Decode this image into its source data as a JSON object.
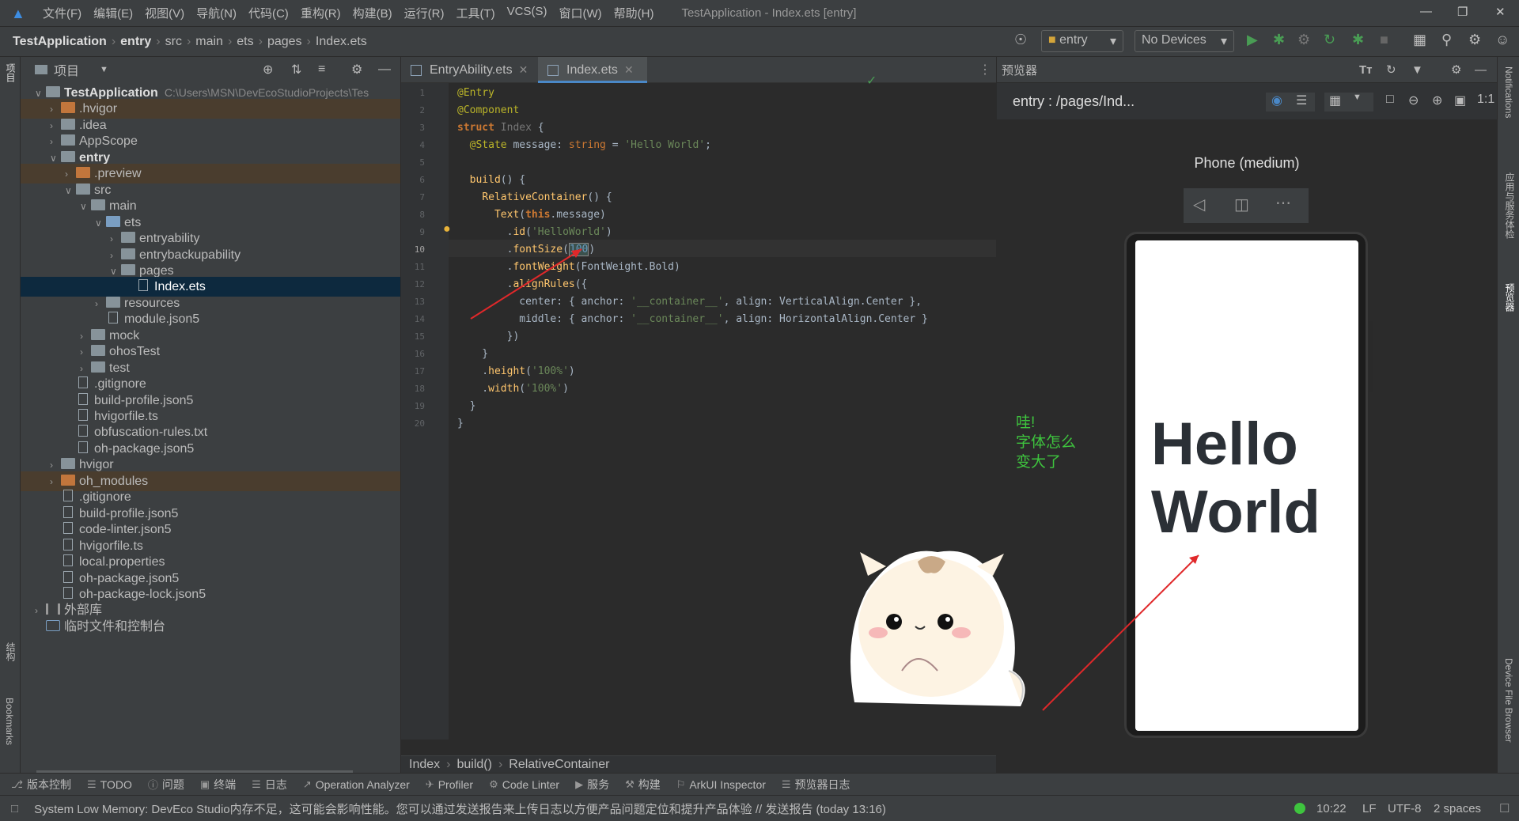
{
  "menu": {
    "items": [
      "文件(F)",
      "编辑(E)",
      "视图(V)",
      "导航(N)",
      "代码(C)",
      "重构(R)",
      "构建(B)",
      "运行(R)",
      "工具(T)",
      "VCS(S)",
      "窗口(W)",
      "帮助(H)"
    ],
    "window_title": "TestApplication - Index.ets [entry]"
  },
  "breadcrumb": [
    "TestApplication",
    "entry",
    "src",
    "main",
    "ets",
    "pages",
    "Index.ets"
  ],
  "toolbar": {
    "module_select": "entry",
    "device_select": "No Devices"
  },
  "project": {
    "header_label": "项目",
    "tree": [
      {
        "depth": 0,
        "arrow": "v",
        "icon": "folder",
        "label": "TestApplication",
        "suffix": "C:\\Users\\MSN\\DevEcoStudioProjects\\Tes",
        "bold": true
      },
      {
        "depth": 1,
        "arrow": ">",
        "icon": "folder-orange",
        "label": ".hvigor",
        "hl": true
      },
      {
        "depth": 1,
        "arrow": ">",
        "icon": "folder",
        "label": ".idea"
      },
      {
        "depth": 1,
        "arrow": ">",
        "icon": "folder",
        "label": "AppScope"
      },
      {
        "depth": 1,
        "arrow": "v",
        "icon": "folder",
        "label": "entry",
        "bold": true
      },
      {
        "depth": 2,
        "arrow": ">",
        "icon": "folder-orange",
        "label": ".preview",
        "hl": true
      },
      {
        "depth": 2,
        "arrow": "v",
        "icon": "folder",
        "label": "src"
      },
      {
        "depth": 3,
        "arrow": "v",
        "icon": "folder",
        "label": "main"
      },
      {
        "depth": 4,
        "arrow": "v",
        "icon": "folder-blue",
        "label": "ets"
      },
      {
        "depth": 5,
        "arrow": ">",
        "icon": "folder",
        "label": "entryability"
      },
      {
        "depth": 5,
        "arrow": ">",
        "icon": "folder",
        "label": "entrybackupability"
      },
      {
        "depth": 5,
        "arrow": "v",
        "icon": "folder",
        "label": "pages"
      },
      {
        "depth": 6,
        "arrow": "",
        "icon": "file",
        "label": "Index.ets",
        "sel": true
      },
      {
        "depth": 4,
        "arrow": ">",
        "icon": "folder",
        "label": "resources"
      },
      {
        "depth": 4,
        "arrow": "",
        "icon": "file",
        "label": "module.json5"
      },
      {
        "depth": 3,
        "arrow": ">",
        "icon": "folder",
        "label": "mock"
      },
      {
        "depth": 3,
        "arrow": ">",
        "icon": "folder",
        "label": "ohosTest"
      },
      {
        "depth": 3,
        "arrow": ">",
        "icon": "folder",
        "label": "test"
      },
      {
        "depth": 2,
        "arrow": "",
        "icon": "file",
        "label": ".gitignore"
      },
      {
        "depth": 2,
        "arrow": "",
        "icon": "file",
        "label": "build-profile.json5"
      },
      {
        "depth": 2,
        "arrow": "",
        "icon": "file",
        "label": "hvigorfile.ts"
      },
      {
        "depth": 2,
        "arrow": "",
        "icon": "file",
        "label": "obfuscation-rules.txt"
      },
      {
        "depth": 2,
        "arrow": "",
        "icon": "file",
        "label": "oh-package.json5"
      },
      {
        "depth": 1,
        "arrow": ">",
        "icon": "folder",
        "label": "hvigor"
      },
      {
        "depth": 1,
        "arrow": ">",
        "icon": "folder-orange",
        "label": "oh_modules",
        "hl": true
      },
      {
        "depth": 1,
        "arrow": "",
        "icon": "file",
        "label": ".gitignore"
      },
      {
        "depth": 1,
        "arrow": "",
        "icon": "file",
        "label": "build-profile.json5"
      },
      {
        "depth": 1,
        "arrow": "",
        "icon": "file",
        "label": "code-linter.json5"
      },
      {
        "depth": 1,
        "arrow": "",
        "icon": "file",
        "label": "hvigorfile.ts"
      },
      {
        "depth": 1,
        "arrow": "",
        "icon": "file",
        "label": "local.properties"
      },
      {
        "depth": 1,
        "arrow": "",
        "icon": "file",
        "label": "oh-package.json5"
      },
      {
        "depth": 1,
        "arrow": "",
        "icon": "file",
        "label": "oh-package-lock.json5"
      },
      {
        "depth": 0,
        "arrow": ">",
        "icon": "lib",
        "label": "外部库"
      },
      {
        "depth": 0,
        "arrow": "",
        "icon": "scratch",
        "label": "临时文件和控制台"
      }
    ]
  },
  "editor": {
    "tabs": [
      {
        "label": "EntryAbility.ets",
        "active": false
      },
      {
        "label": "Index.ets",
        "active": true
      }
    ],
    "line_numbers": [
      "1",
      "2",
      "3",
      "4",
      "5",
      "6",
      "7",
      "8",
      "9",
      "10",
      "11",
      "12",
      "13",
      "14",
      "15",
      "16",
      "17",
      "18",
      "19",
      "20"
    ],
    "footer": [
      "Index",
      "build()",
      "RelativeContainer"
    ]
  },
  "preview": {
    "header_label": "预览器",
    "route": "entry : /pages/Ind...",
    "device_label": "Phone (medium)",
    "hello_text": "Hello World",
    "annotation": [
      "哇!",
      "字体怎么",
      "变大了"
    ]
  },
  "right_strip": [
    "Notifications",
    "应用与服务体检",
    "预览器",
    "Device File Browser"
  ],
  "left_strip": [
    "项目",
    "结构",
    "Bookmarks"
  ],
  "bottom_tools": [
    "版本控制",
    "TODO",
    "问题",
    "终端",
    "日志",
    "Operation Analyzer",
    "Profiler",
    "Code Linter",
    "服务",
    "构建",
    "ArkUI Inspector",
    "预览器日志"
  ],
  "status": {
    "message": "System Low Memory: DevEco Studio内存不足，这可能会影响性能。您可以通过发送报告来上传日志以方便产品问题定位和提升产品体验 // 发送报告 (today 13:16)",
    "position": "10:22",
    "line_sep": "LF",
    "encoding": "UTF-8",
    "indent": "2 spaces"
  },
  "colors": {
    "accent": "#4a88c7",
    "selection": "#0d293e",
    "green_note": "#3ec43e",
    "arrow_red": "#e0282a"
  }
}
